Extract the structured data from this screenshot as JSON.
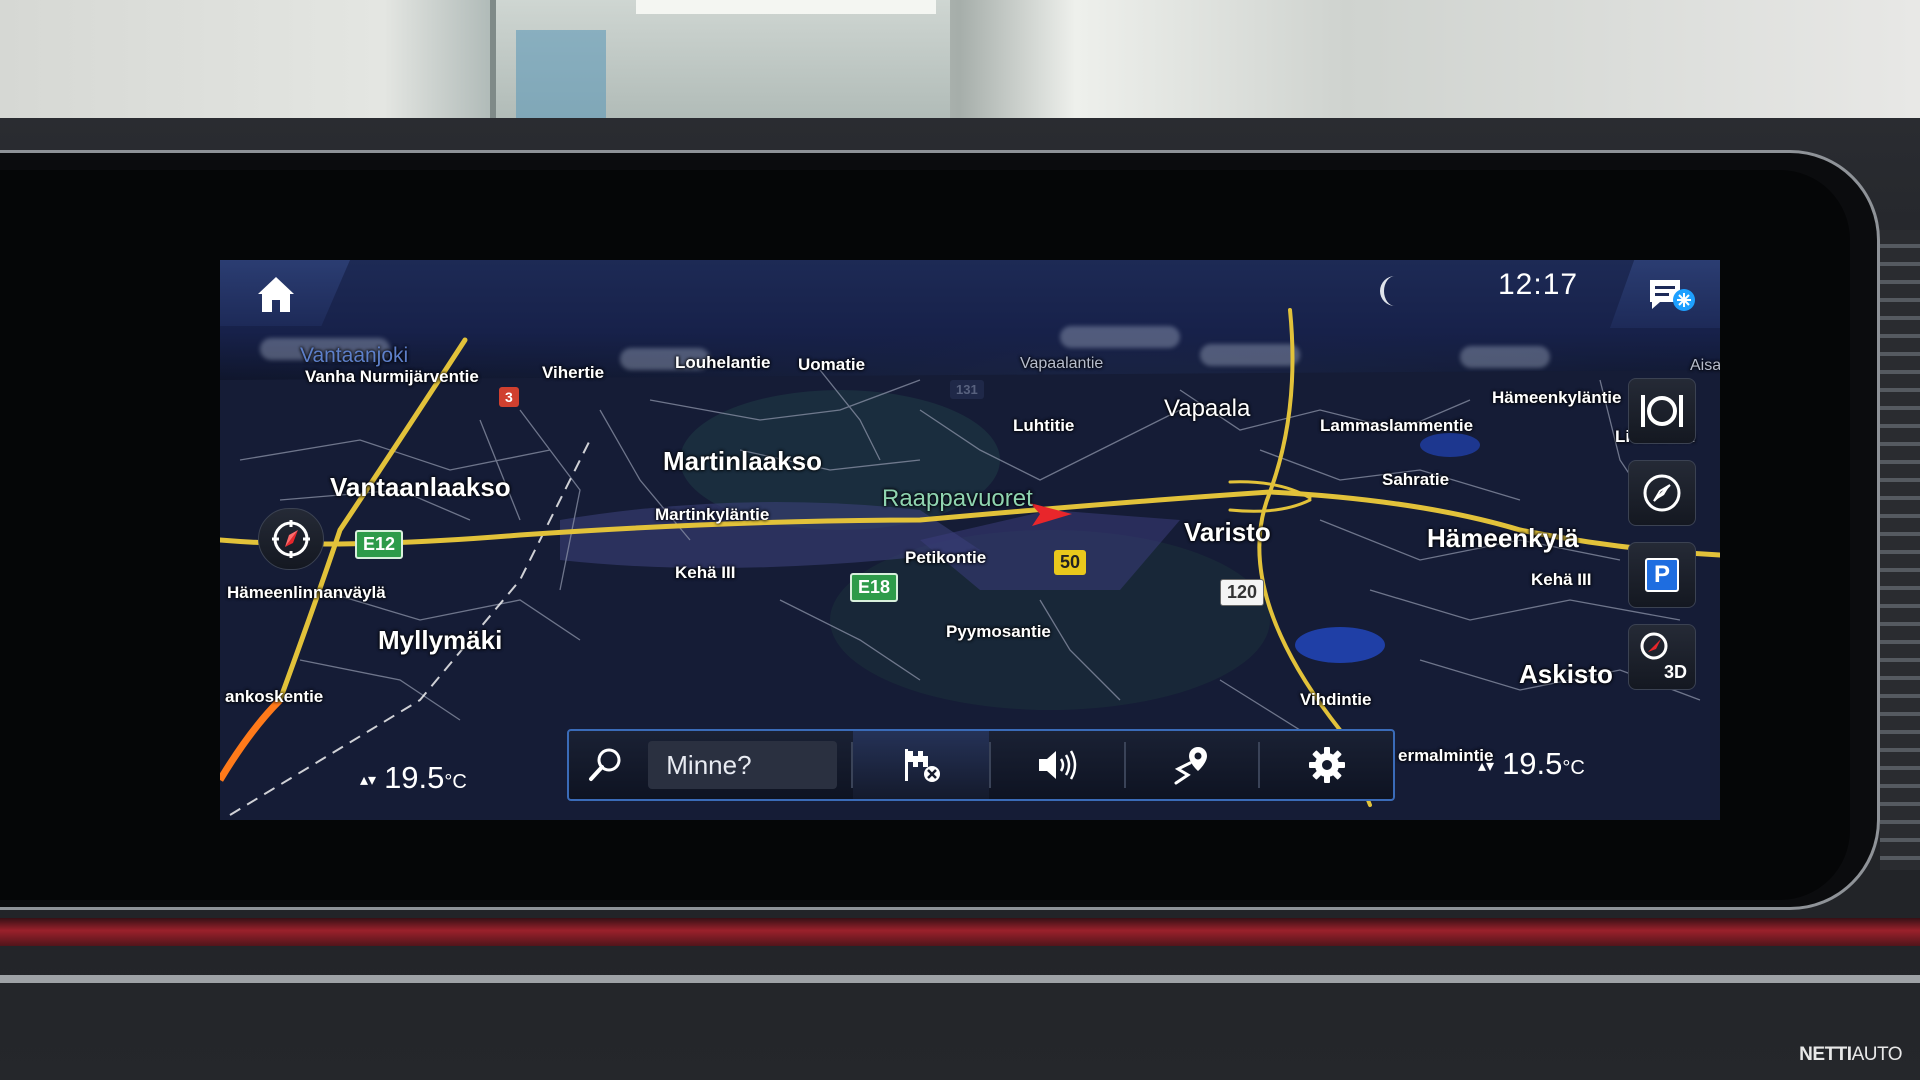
{
  "status": {
    "time": "12:17"
  },
  "map": {
    "places_large": [
      {
        "id": "vantaanlaakso",
        "name": "Vantaanlaakso"
      },
      {
        "id": "martinlaakso",
        "name": "Martinlaakso"
      },
      {
        "id": "myllymaki",
        "name": "Myllymäki"
      },
      {
        "id": "varisto",
        "name": "Varisto"
      },
      {
        "id": "hameenkyla",
        "name": "Hämeenkylä"
      },
      {
        "id": "askisto",
        "name": "Askisto"
      },
      {
        "id": "vapaala",
        "name": "Vapaala"
      }
    ],
    "area_label": "Raappavuoret",
    "river_label": "Vantaanjoki",
    "streets": [
      {
        "id": "vanha-nurmijarventie",
        "name": "Vanha Nurmijärventie"
      },
      {
        "id": "vihertie",
        "name": "Vihertie"
      },
      {
        "id": "louhelantie",
        "name": "Louhelantie"
      },
      {
        "id": "uomatie",
        "name": "Uomatie"
      },
      {
        "id": "vapaalantie",
        "name": "Vapaalantie"
      },
      {
        "id": "luhtitie",
        "name": "Luhtitie"
      },
      {
        "id": "hameenkylantie",
        "name": "Hämeenkyläntie"
      },
      {
        "id": "lammaslammentie",
        "name": "Lammaslammentie"
      },
      {
        "id": "sahratie",
        "name": "Sahratie"
      },
      {
        "id": "martinkylantie",
        "name": "Martinkyläntie"
      },
      {
        "id": "keha-iii-west",
        "name": "Kehä III"
      },
      {
        "id": "petikontie",
        "name": "Petikontie"
      },
      {
        "id": "keha-iii-east",
        "name": "Kehä III"
      },
      {
        "id": "hameenlinnanvayla",
        "name": "Hämeenlinnanväylä"
      },
      {
        "id": "pyymosantie",
        "name": "Pyymosantie"
      },
      {
        "id": "vihdintie",
        "name": "Vihdintie"
      },
      {
        "id": "ankoskentie",
        "name": "ankoskentie"
      },
      {
        "id": "ermalmintie",
        "name": "ermalmintie"
      },
      {
        "id": "linnainen",
        "name": "Linnainen"
      },
      {
        "id": "aisa",
        "name": "Aisa"
      }
    ],
    "shields": {
      "e12": "E12",
      "e18": "E18",
      "r3": "3",
      "r50": "50",
      "r120": "120",
      "r131": "131"
    }
  },
  "climate": {
    "left_temp": "19.5",
    "right_temp": "19.5",
    "unit": "°C"
  },
  "bottom_bar": {
    "search_placeholder": "Minne?"
  },
  "side_buttons": {
    "three_d_label": "3D",
    "parking_label": "P"
  },
  "watermark": {
    "brand_a": "NETTI",
    "brand_b": "AUTO"
  },
  "colors": {
    "accent": "#3a6bb8",
    "motorway": "#e2c23a",
    "route_orange": "#ff7a1a",
    "area_green": "#8fd4b0",
    "marker_red": "#e8262b"
  }
}
